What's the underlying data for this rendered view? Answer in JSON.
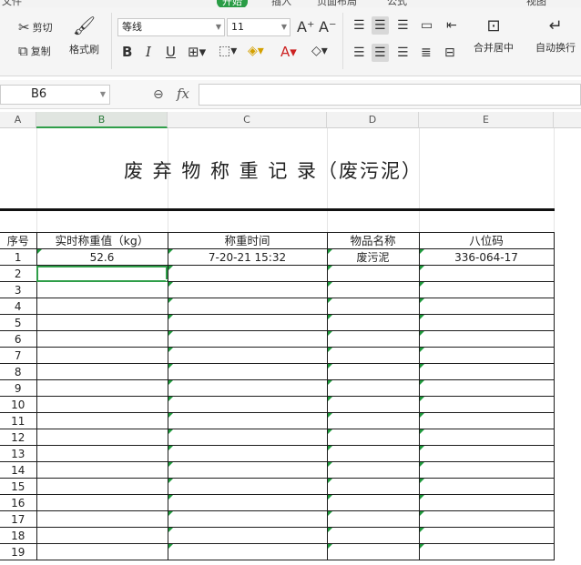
{
  "menu": {
    "tabs": [
      "文件",
      "开始",
      "插入",
      "页面布局",
      "公式",
      "视图"
    ]
  },
  "ribbon": {
    "cut_label": "剪切",
    "copy_label": "复制",
    "format_painter_label": "格式刷",
    "font_name": "等线",
    "font_size": "11",
    "merge_center_label": "合并居中",
    "wrap_text_label": "自动换行"
  },
  "formula_bar": {
    "cell_ref": "B6",
    "fx_label": "fx",
    "formula_value": ""
  },
  "columns": [
    "A",
    "B",
    "C",
    "D",
    "E"
  ],
  "sheet": {
    "title": "废 弃 物 称 重 记 录（废污泥）",
    "headers": [
      "序号",
      "实时称重值（kg）",
      "称重时间",
      "物品名称",
      "八位码"
    ],
    "rows": [
      [
        "1",
        "52.6",
        "7-20-21 15:32",
        "废污泥",
        "336-064-17"
      ],
      [
        "2",
        "",
        "",
        "",
        ""
      ],
      [
        "3",
        "",
        "",
        "",
        ""
      ],
      [
        "4",
        "",
        "",
        "",
        ""
      ],
      [
        "5",
        "",
        "",
        "",
        ""
      ],
      [
        "6",
        "",
        "",
        "",
        ""
      ],
      [
        "7",
        "",
        "",
        "",
        ""
      ],
      [
        "8",
        "",
        "",
        "",
        ""
      ],
      [
        "9",
        "",
        "",
        "",
        ""
      ],
      [
        "10",
        "",
        "",
        "",
        ""
      ],
      [
        "11",
        "",
        "",
        "",
        ""
      ],
      [
        "12",
        "",
        "",
        "",
        ""
      ],
      [
        "13",
        "",
        "",
        "",
        ""
      ],
      [
        "14",
        "",
        "",
        "",
        ""
      ],
      [
        "15",
        "",
        "",
        "",
        ""
      ],
      [
        "16",
        "",
        "",
        "",
        ""
      ],
      [
        "17",
        "",
        "",
        "",
        ""
      ],
      [
        "18",
        "",
        "",
        "",
        ""
      ],
      [
        "19",
        "",
        "",
        "",
        ""
      ]
    ]
  },
  "colors": {
    "accent": "#2f9e49",
    "indicator": "#1e9a3c"
  }
}
